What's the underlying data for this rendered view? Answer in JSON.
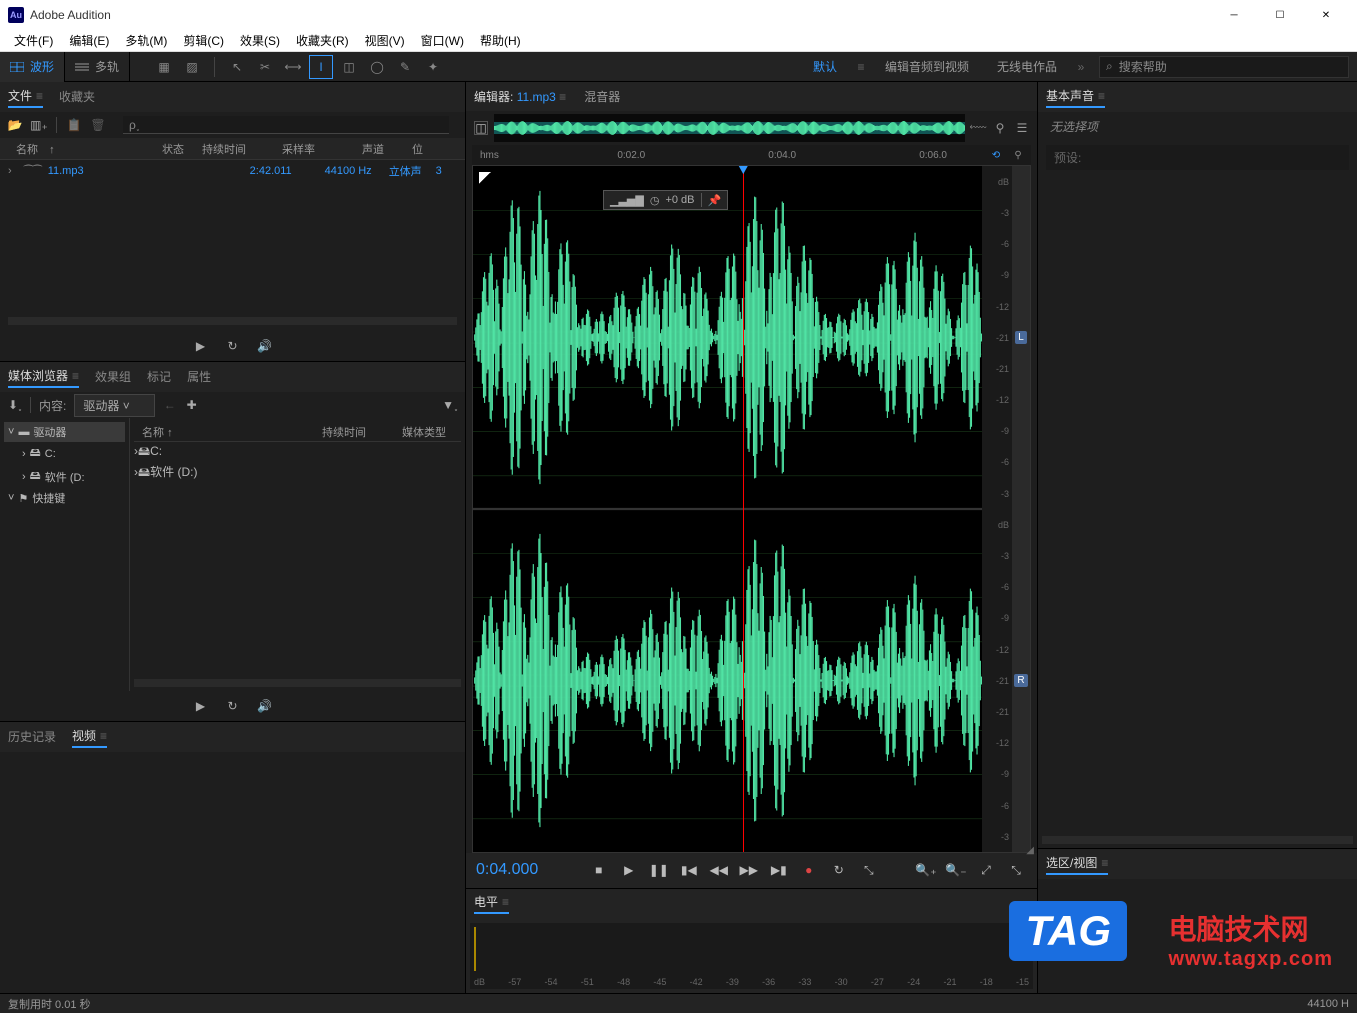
{
  "window": {
    "title": "Adobe Audition",
    "logo": "Au"
  },
  "menus": [
    "文件(F)",
    "编辑(E)",
    "多轨(M)",
    "剪辑(C)",
    "效果(S)",
    "收藏夹(R)",
    "视图(V)",
    "窗口(W)",
    "帮助(H)"
  ],
  "toolbar": {
    "waveform": "波形",
    "multitrack": "多轨"
  },
  "workspaces": {
    "default": "默认",
    "audio_to_video": "编辑音频到视频",
    "radio": "无线电作品"
  },
  "search": {
    "placeholder": "搜索帮助"
  },
  "files_panel": {
    "tabs": [
      "文件",
      "收藏夹"
    ],
    "headers": {
      "name": "名称",
      "arrow": "↑",
      "status": "状态",
      "duration": "持续时间",
      "sample_rate": "采样率",
      "channels": "声道",
      "bits": "位"
    },
    "rows": [
      {
        "name": "11.mp3",
        "duration": "2:42.011",
        "sample_rate": "44100 Hz",
        "channels": "立体声",
        "bits": "3"
      }
    ]
  },
  "media_panel": {
    "tabs": [
      "媒体浏览器",
      "效果组",
      "标记",
      "属性"
    ],
    "content_label": "内容:",
    "content_value": "驱动器",
    "tree": [
      {
        "label": "驱动器",
        "level": 0,
        "sel": true
      },
      {
        "label": "C:",
        "level": 1
      },
      {
        "label": "软件 (D:",
        "level": 1
      },
      {
        "label": "快捷键",
        "level": 0
      }
    ],
    "list_header": {
      "name": "名称",
      "arrow": "↑",
      "duration": "持续时间",
      "type": "媒体类型"
    },
    "list": [
      {
        "name": "C:"
      },
      {
        "name": "软件 (D:)"
      }
    ]
  },
  "history_panel": {
    "tabs": [
      "历史记录",
      "视频"
    ]
  },
  "editor": {
    "tabs": {
      "editor": "编辑器:",
      "file": "11.mp3",
      "mixer": "混音器"
    },
    "time_ticks": [
      "hms",
      "0:02.0",
      "0:04.0",
      "0:06.0"
    ],
    "db_ticks": [
      "dB",
      "-3",
      "-6",
      "-9",
      "-12",
      "-21",
      "-21",
      "-12",
      "-9",
      "-6",
      "-3"
    ],
    "hud": {
      "db": "+0 dB"
    },
    "channel_l": "L",
    "channel_r": "R",
    "current_time": "0:04.000"
  },
  "levels": {
    "title": "电平",
    "scale": [
      "dB",
      "-57",
      "-54",
      "-51",
      "-48",
      "-45",
      "-42",
      "-39",
      "-36",
      "-33",
      "-30",
      "-27",
      "-24",
      "-21",
      "-18",
      "-15"
    ]
  },
  "ess": {
    "title": "基本声音",
    "no_selection": "无选择项",
    "preset": "预设:"
  },
  "sel": {
    "title": "选区/视图"
  },
  "status": {
    "copy_time": "复制用时 0.01 秒",
    "sample_rate": "44100 H"
  },
  "watermark": {
    "tag": "TAG",
    "line1": "电脑技术网",
    "line2": "www.tagxp.com"
  }
}
